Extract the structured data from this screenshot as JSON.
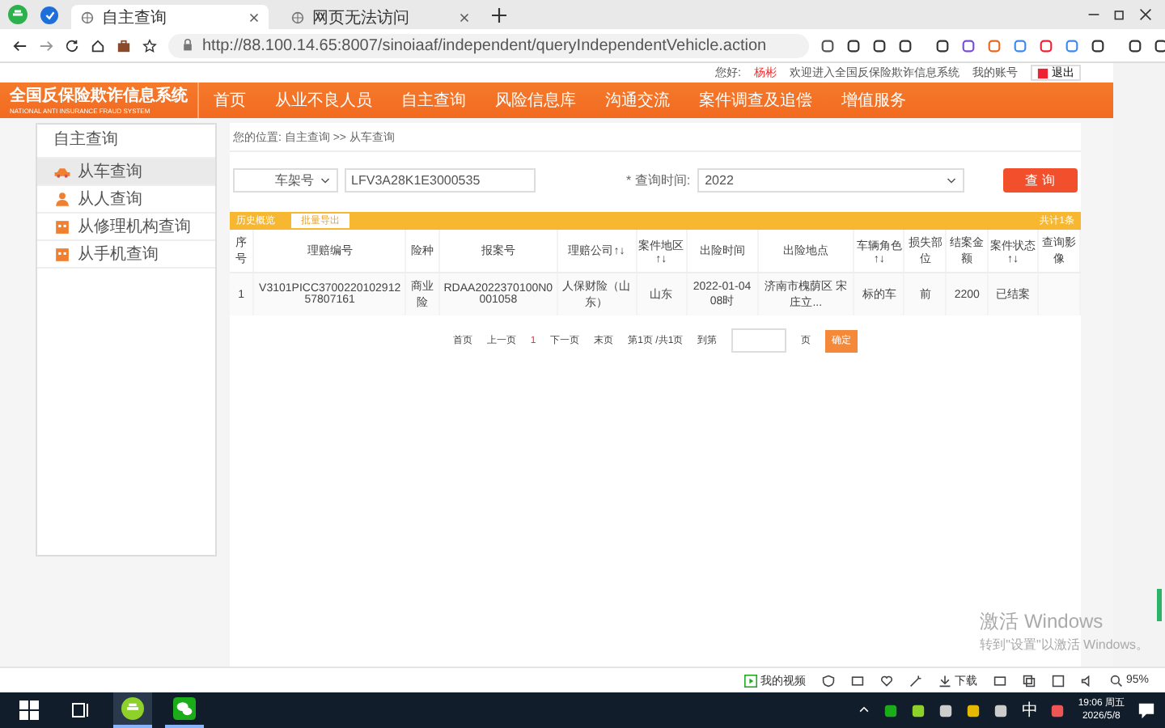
{
  "browser": {
    "tabs": [
      {
        "title": "自主查询",
        "selected": true
      },
      {
        "title": "网页无法访问",
        "selected": false
      }
    ],
    "url": "http://88.100.14.65:8007/sinoiaaf/independent/queryIndependentVehicle.action"
  },
  "header": {
    "greeting": "您好:",
    "user": "杨彬",
    "welcome": "欢迎进入全国反保险欺诈信息系统",
    "account": "我的账号",
    "logout": "退出"
  },
  "logo": {
    "title": "全国反保险欺诈信息系统",
    "subtitle": "NATIONAL ANTI INSURANCE FRAUD SYSTEM"
  },
  "nav": [
    "首页",
    "从业不良人员",
    "自主查询",
    "风险信息库",
    "沟通交流",
    "案件调查及追偿",
    "增值服务"
  ],
  "sidebar": {
    "title": "自主查询",
    "items": [
      {
        "label": "从车查询",
        "selected": true
      },
      {
        "label": "从人查询",
        "selected": false
      },
      {
        "label": "从修理机构查询",
        "selected": false
      },
      {
        "label": "从手机查询",
        "selected": false
      }
    ]
  },
  "breadcrumb": "您的位置: 自主查询 >> 从车查询",
  "search": {
    "field_type": "车架号",
    "value": "LFV3A28K1E3000535",
    "time_label": "* 查询时间:",
    "year": "2022",
    "button": "查 询"
  },
  "results": {
    "title": "历史概览",
    "export": "批量导出",
    "total": "共计1条",
    "columns": [
      "序号",
      "理赔编号",
      "险种",
      "报案号",
      "理赔公司↑↓",
      "案件地区↑↓",
      "出险时间",
      "出险地点",
      "车辆角色↑↓",
      "损失部位",
      "结案金额",
      "案件状态↑↓",
      "查询影像"
    ],
    "rows": [
      [
        "1",
        "V3101PICC370022010291257807161",
        "商业险",
        "RDAA2022370100N0001058",
        "人保财险（山东）",
        "山东",
        "2022-01-04 08时",
        "济南市槐荫区 宋庄立...",
        "标的车",
        "前",
        "2200",
        "已结案",
        ""
      ]
    ]
  },
  "pagination": {
    "first": "首页",
    "prev": "上一页",
    "current": "1",
    "next": "下一页",
    "last": "末页",
    "info": "第1页 /共1页",
    "goto": "到第",
    "unit": "页",
    "confirm": "确定"
  },
  "status_bar": {
    "video": "我的视频",
    "download": "下载",
    "zoom": "95%"
  },
  "activation": {
    "title": "激活 Windows",
    "hint": "转到\"设置\"以激活 Windows。"
  },
  "taskbar": {
    "ime": "中",
    "time": "19:06 周五",
    "date": "2026/5/8"
  }
}
